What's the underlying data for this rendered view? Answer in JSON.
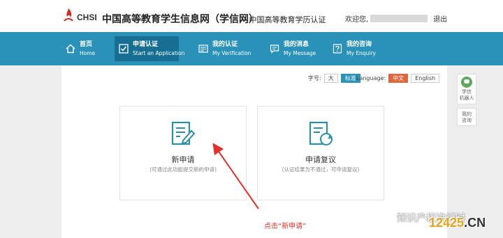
{
  "header": {
    "logo_text": "CHSI",
    "site_title": "中国高等教育学生信息网（学信网）",
    "site_subtitle": "— 中国高等教育学历认证",
    "welcome": "欢迎您,",
    "logout": "退出"
  },
  "nav": {
    "items": [
      {
        "cn": "首页",
        "en": "Home",
        "icon": "home-icon"
      },
      {
        "cn": "申请认证",
        "en": "Start an Application",
        "icon": "check-icon"
      },
      {
        "cn": "我的认证",
        "en": "My Verification",
        "icon": "document-icon"
      },
      {
        "cn": "我的消息",
        "en": "My Message",
        "icon": "message-icon"
      },
      {
        "cn": "我的咨询",
        "en": "My Enquiry",
        "icon": "question-icon"
      }
    ],
    "active_index": 1
  },
  "toolbar": {
    "font_size_label": "字号:",
    "font_large": "大",
    "font_standard": "标准",
    "language_label": "Language:",
    "lang_zh": "中文",
    "lang_en": "English"
  },
  "cards": [
    {
      "title": "新申请",
      "desc": "(可通过此功能提交新的申请)",
      "icon": "edit-document-icon"
    },
    {
      "title": "申请复议",
      "desc": "(认证结果为不通过，可申请复议)",
      "icon": "refresh-document-icon"
    }
  ],
  "side": {
    "robot": "学信机器人",
    "robot_line1": "学信",
    "robot_line2": "机器人",
    "enquiry_line1": "我的",
    "enquiry_line2": "咨询"
  },
  "annotation": "点击“新申请”",
  "watermark": {
    "text": "知识产权进行时",
    "domain": "12425",
    "domain_suffix": ".CN"
  },
  "colors": {
    "nav_bg": "#2a92b8",
    "nav_active": "#166f92",
    "accent_red": "#e0673d",
    "icon_teal": "#2a8fa8",
    "annotation_red": "#e0312a"
  }
}
